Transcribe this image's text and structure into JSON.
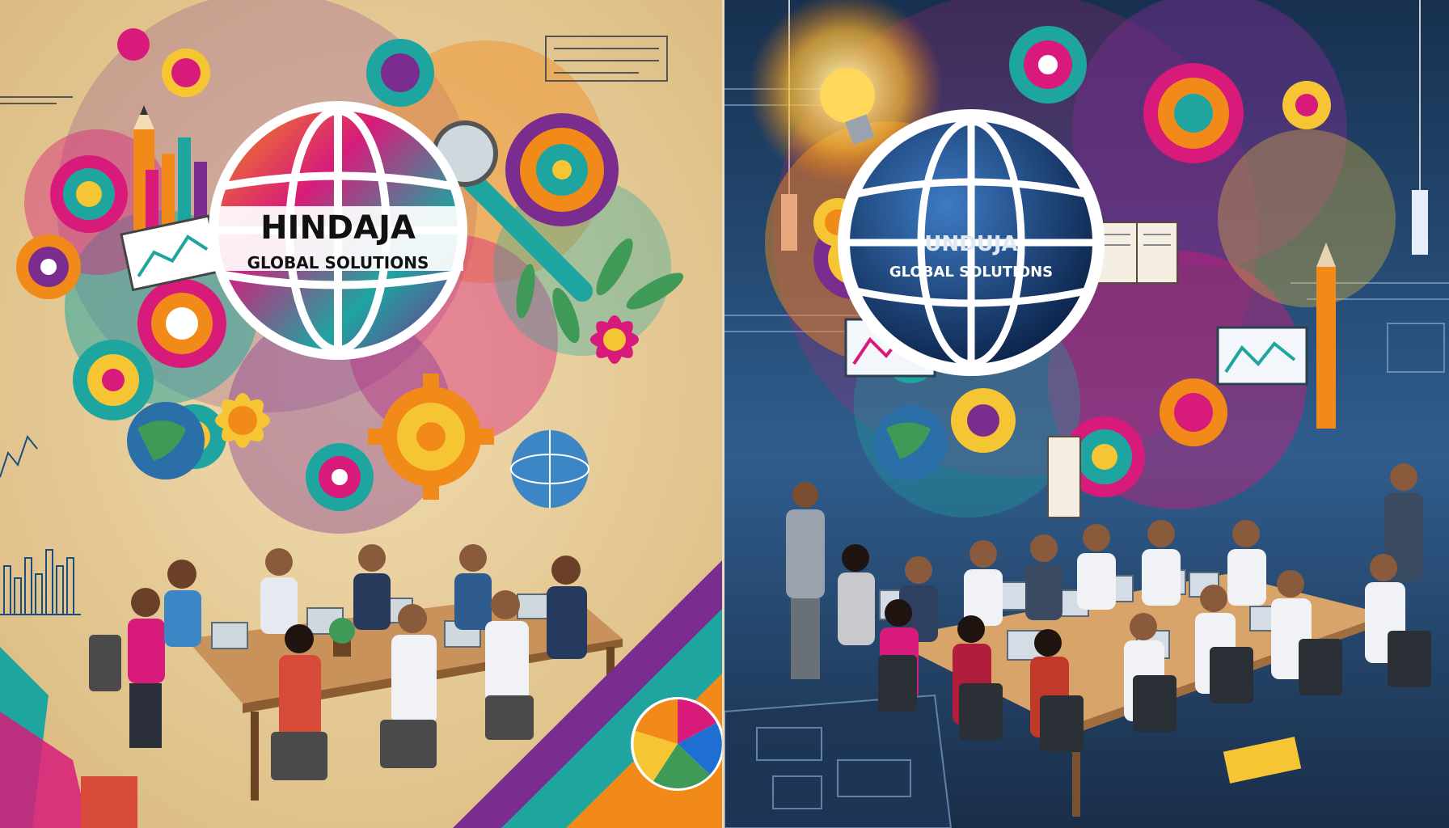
{
  "left_panel": {
    "logo": {
      "line1": "HINDAJA",
      "line2": "GLOBAL SOLUTIONS"
    },
    "colors": {
      "background": "#e8cf99",
      "table": "#c9925a"
    }
  },
  "right_panel": {
    "logo": {
      "line1": "UNDUJA",
      "line2": "GLOBAL SOLUTIONS"
    },
    "colors": {
      "background": "#1d3a5e",
      "globe": "#0f2b55",
      "table": "#d8a46a"
    }
  },
  "colors": {
    "magenta": "#d81b7a",
    "orange": "#f28a1a",
    "teal": "#1ea5a0",
    "yellow": "#f6c534",
    "purple": "#7b2c8f"
  }
}
